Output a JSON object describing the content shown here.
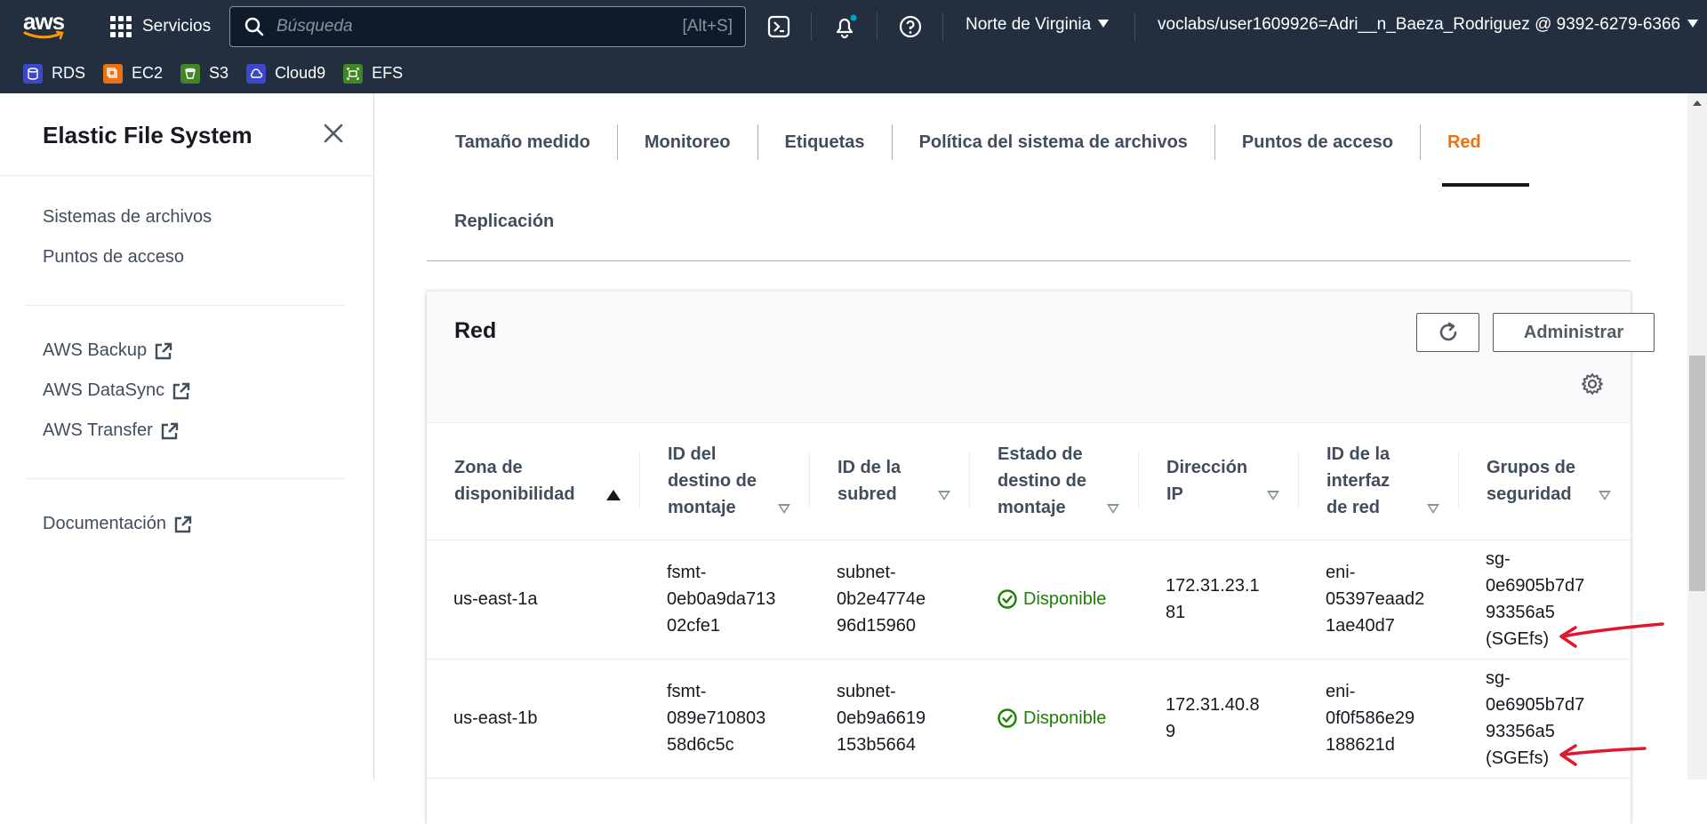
{
  "topbar": {
    "logo_text": "aws",
    "services_label": "Servicios",
    "search_placeholder": "Búsqueda",
    "search_shortcut": "[Alt+S]",
    "region": "Norte de Virginia",
    "account": "voclabs/user1609926=Adri__n_Baeza_Rodriguez @ 9392-6279-6366",
    "favorites": [
      {
        "label": "RDS",
        "color": "#3b48cc"
      },
      {
        "label": "EC2",
        "color": "#ec7211"
      },
      {
        "label": "S3",
        "color": "#3f8624"
      },
      {
        "label": "Cloud9",
        "color": "#3b48cc"
      },
      {
        "label": "EFS",
        "color": "#3f8624"
      }
    ]
  },
  "sidebar": {
    "title": "Elastic File System",
    "nav": [
      "Sistemas de archivos",
      "Puntos de acceso"
    ],
    "external": [
      "AWS Backup",
      "AWS DataSync",
      "AWS Transfer"
    ],
    "docs": "Documentación"
  },
  "tabs": [
    "Tamaño medido",
    "Monitoreo",
    "Etiquetas",
    "Política del sistema de archivos",
    "Puntos de acceso",
    "Red"
  ],
  "tab_row2": "Replicación",
  "active_tab": "Red",
  "panel": {
    "title": "Red",
    "manage_button": "Administrar",
    "columns": [
      {
        "l1": "Zona de",
        "l2": "disponibilidad",
        "l3": ""
      },
      {
        "l1": "ID del",
        "l2": "destino de",
        "l3": "montaje"
      },
      {
        "l1": "ID de la",
        "l2": "subred",
        "l3": ""
      },
      {
        "l1": "Estado de",
        "l2": "destino de",
        "l3": "montaje"
      },
      {
        "l1": "Dirección",
        "l2": "IP",
        "l3": ""
      },
      {
        "l1": "ID de la",
        "l2": "interfaz",
        "l3": "de red"
      },
      {
        "l1": "Grupos de",
        "l2": "seguridad",
        "l3": ""
      }
    ],
    "rows": [
      {
        "zone": "us-east-1a",
        "mount": [
          "fsmt-",
          "0eb0a9da713",
          "02cfe1"
        ],
        "subnet": [
          "subnet-",
          "0b2e4774e",
          "96d15960"
        ],
        "status": "Disponible",
        "ip": [
          "172.31.23.1",
          "81"
        ],
        "eni": [
          "eni-",
          "05397eaad2",
          "1ae40d7"
        ],
        "sg": [
          "sg-",
          "0e6905b7d7",
          "93356a5",
          "(SGEfs)"
        ]
      },
      {
        "zone": "us-east-1b",
        "mount": [
          "fsmt-",
          "089e710803",
          "58d6c5c"
        ],
        "subnet": [
          "subnet-",
          "0eb9a6619",
          "153b5664"
        ],
        "status": "Disponible",
        "ip": [
          "172.31.40.8",
          "9"
        ],
        "eni": [
          "eni-",
          "0f0f586e29",
          "188621d"
        ],
        "sg": [
          "sg-",
          "0e6905b7d7",
          "93356a5",
          "(SGEfs)"
        ]
      }
    ]
  },
  "colors": {
    "topbar_bg": "#232f3e",
    "accent": "#ec7211",
    "status_ok": "#1d8102",
    "annotation_arrow": "#e0182d"
  }
}
